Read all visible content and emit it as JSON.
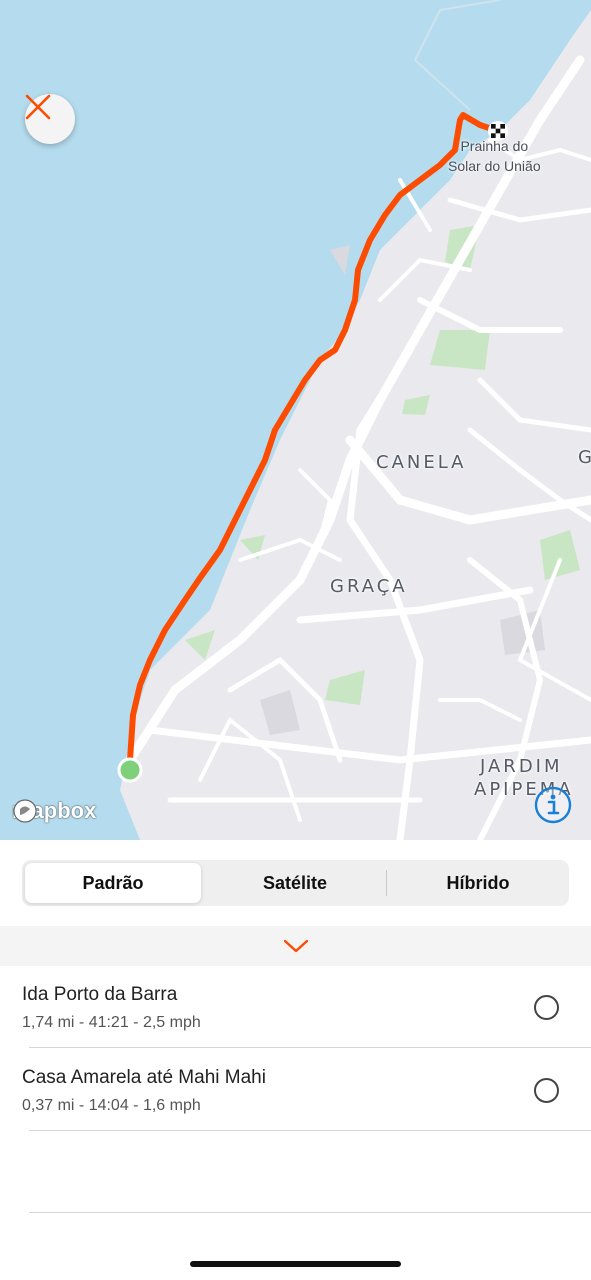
{
  "map": {
    "close_icon": "close-icon",
    "labels": {
      "canela": "CANELA",
      "graca": "GRAÇA",
      "jardim": "JARDIM",
      "apipema": "APIPEMA",
      "edge_g": "G"
    },
    "poi": {
      "line1": "Prainha do",
      "line2": "Solar do União"
    },
    "attribution": "mapbox",
    "info_icon": "info-icon",
    "route_color": "#fc4c02",
    "start_marker_color": "#7ed17a",
    "water_color": "#b5dcee",
    "land_color": "#e9e9ee",
    "park_color": "#c9e6c4"
  },
  "map_types": {
    "options": [
      "Padrão",
      "Satélite",
      "Híbrido"
    ],
    "selected": "Padrão"
  },
  "collapse_icon": "chevron-down-icon",
  "activities": [
    {
      "title": "Ida Porto da Barra",
      "stats": "1,74 mi - 41:21 - 2,5 mph",
      "selected": false
    },
    {
      "title": "Casa Amarela até Mahi Mahi",
      "stats": "0,37 mi - 14:04 - 1,6 mph",
      "selected": false
    }
  ],
  "accent_color": "#fc4c02"
}
